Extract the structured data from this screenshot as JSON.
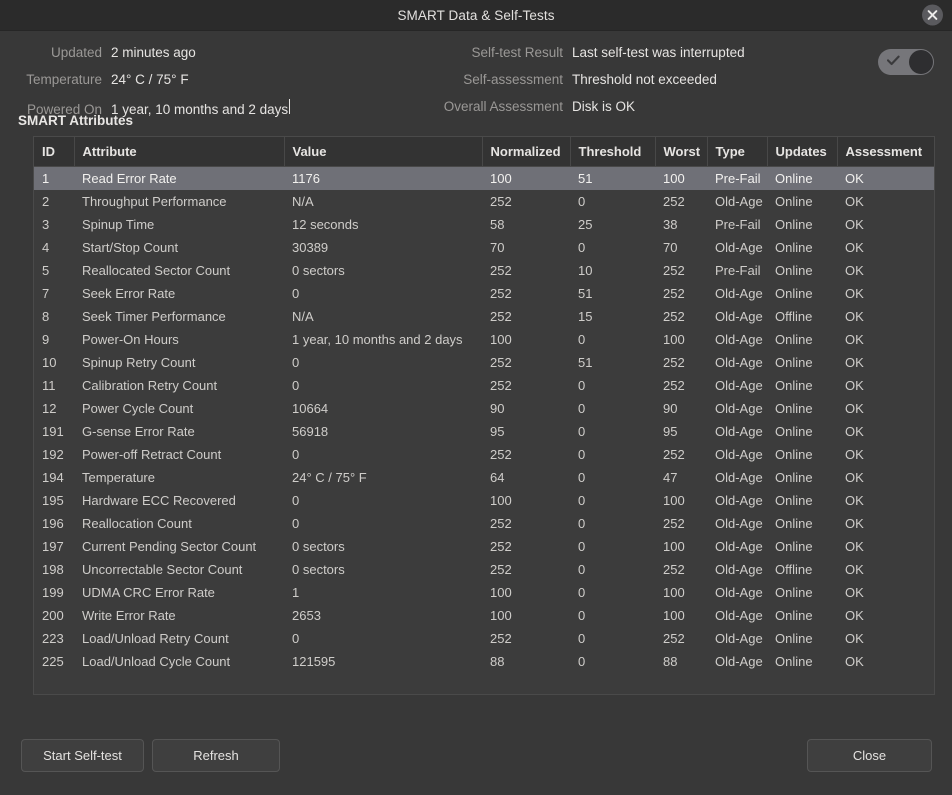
{
  "window": {
    "title": "SMART Data & Self-Tests",
    "close_icon": "close-icon"
  },
  "info": {
    "left": [
      {
        "label": "Updated",
        "value": "2 minutes ago"
      },
      {
        "label": "Temperature",
        "value": "24° C / 75° F"
      },
      {
        "label": "Powered On",
        "value": "1 year, 10 months and 2 days"
      }
    ],
    "right": [
      {
        "label": "Self-test Result",
        "value": "Last self-test was interrupted"
      },
      {
        "label": "Self-assessment",
        "value": "Threshold not exceeded"
      },
      {
        "label": "Overall Assessment",
        "value": "Disk is OK"
      }
    ],
    "toggle": {
      "name": "smart-enabled-toggle",
      "state": "on",
      "icon": "check-icon"
    }
  },
  "section_title": "SMART Attributes",
  "table": {
    "columns": [
      "ID",
      "Attribute",
      "Value",
      "Normalized",
      "Threshold",
      "Worst",
      "Type",
      "Updates",
      "Assessment"
    ],
    "selected_row_index": 0,
    "rows": [
      [
        "1",
        "Read Error Rate",
        "1176",
        "100",
        "51",
        "100",
        "Pre-Fail",
        "Online",
        "OK"
      ],
      [
        "2",
        "Throughput Performance",
        "N/A",
        "252",
        "0",
        "252",
        "Old-Age",
        "Online",
        "OK"
      ],
      [
        "3",
        "Spinup Time",
        "12 seconds",
        "58",
        "25",
        "38",
        "Pre-Fail",
        "Online",
        "OK"
      ],
      [
        "4",
        "Start/Stop Count",
        "30389",
        "70",
        "0",
        "70",
        "Old-Age",
        "Online",
        "OK"
      ],
      [
        "5",
        "Reallocated Sector Count",
        "0 sectors",
        "252",
        "10",
        "252",
        "Pre-Fail",
        "Online",
        "OK"
      ],
      [
        "7",
        "Seek Error Rate",
        "0",
        "252",
        "51",
        "252",
        "Old-Age",
        "Online",
        "OK"
      ],
      [
        "8",
        "Seek Timer Performance",
        "N/A",
        "252",
        "15",
        "252",
        "Old-Age",
        "Offline",
        "OK"
      ],
      [
        "9",
        "Power-On Hours",
        "1 year, 10 months and 2 days",
        "100",
        "0",
        "100",
        "Old-Age",
        "Online",
        "OK"
      ],
      [
        "10",
        "Spinup Retry Count",
        "0",
        "252",
        "51",
        "252",
        "Old-Age",
        "Online",
        "OK"
      ],
      [
        "11",
        "Calibration Retry Count",
        "0",
        "252",
        "0",
        "252",
        "Old-Age",
        "Online",
        "OK"
      ],
      [
        "12",
        "Power Cycle Count",
        "10664",
        "90",
        "0",
        "90",
        "Old-Age",
        "Online",
        "OK"
      ],
      [
        "191",
        "G-sense Error Rate",
        "56918",
        "95",
        "0",
        "95",
        "Old-Age",
        "Online",
        "OK"
      ],
      [
        "192",
        "Power-off Retract Count",
        "0",
        "252",
        "0",
        "252",
        "Old-Age",
        "Online",
        "OK"
      ],
      [
        "194",
        "Temperature",
        "24° C / 75° F",
        "64",
        "0",
        "47",
        "Old-Age",
        "Online",
        "OK"
      ],
      [
        "195",
        "Hardware ECC Recovered",
        "0",
        "100",
        "0",
        "100",
        "Old-Age",
        "Online",
        "OK"
      ],
      [
        "196",
        "Reallocation Count",
        "0",
        "252",
        "0",
        "252",
        "Old-Age",
        "Online",
        "OK"
      ],
      [
        "197",
        "Current Pending Sector Count",
        "0 sectors",
        "252",
        "0",
        "100",
        "Old-Age",
        "Online",
        "OK"
      ],
      [
        "198",
        "Uncorrectable Sector Count",
        "0 sectors",
        "252",
        "0",
        "252",
        "Old-Age",
        "Offline",
        "OK"
      ],
      [
        "199",
        "UDMA CRC Error Rate",
        "1",
        "100",
        "0",
        "100",
        "Old-Age",
        "Online",
        "OK"
      ],
      [
        "200",
        "Write Error Rate",
        "2653",
        "100",
        "0",
        "100",
        "Old-Age",
        "Online",
        "OK"
      ],
      [
        "223",
        "Load/Unload Retry Count",
        "0",
        "252",
        "0",
        "252",
        "Old-Age",
        "Online",
        "OK"
      ],
      [
        "225",
        "Load/Unload Cycle Count",
        "121595",
        "88",
        "0",
        "88",
        "Old-Age",
        "Online",
        "OK"
      ]
    ]
  },
  "footer": {
    "start_self_test": "Start Self-test",
    "refresh": "Refresh",
    "close": "Close"
  },
  "colors": {
    "window_bg": "#383838",
    "titlebar_bg": "#2b2b2b",
    "table_bg": "#3c3c3c",
    "table_header_bg": "#333333",
    "selection_bg": "#6f7077",
    "label_fg": "#9a9896",
    "value_fg": "#e6e4e2"
  }
}
